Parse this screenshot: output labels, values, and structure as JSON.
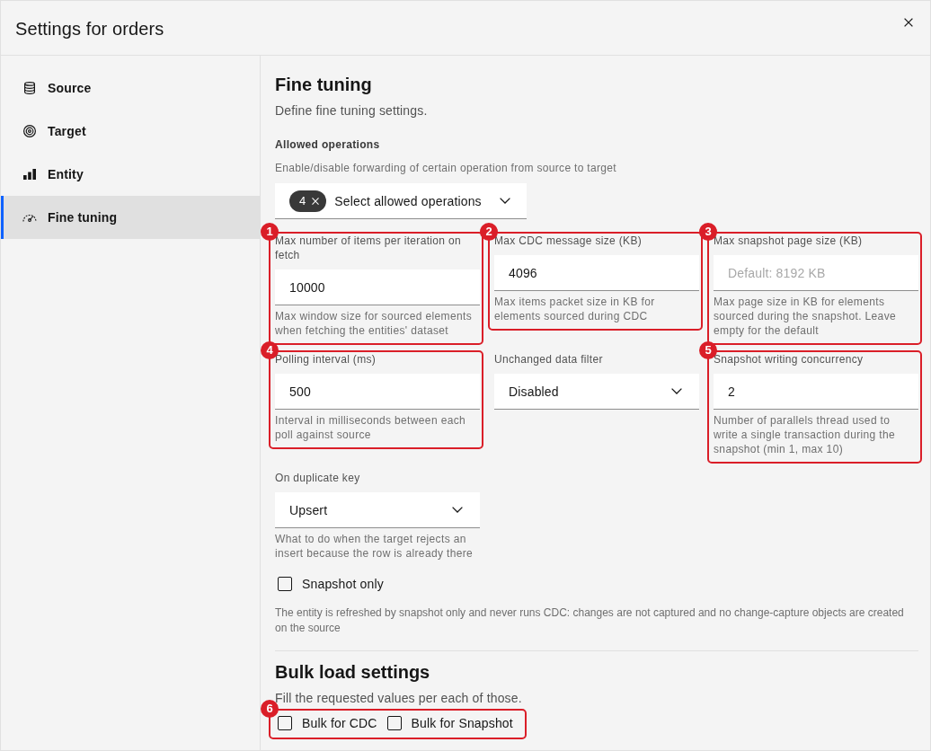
{
  "window": {
    "title": "Settings for orders"
  },
  "sidebar": {
    "items": [
      {
        "kind": "source",
        "label": "Source",
        "selected": false
      },
      {
        "kind": "target",
        "label": "Target",
        "selected": false
      },
      {
        "kind": "entity",
        "label": "Entity",
        "selected": false
      },
      {
        "kind": "tuning",
        "label": "Fine tuning",
        "selected": true
      }
    ]
  },
  "main": {
    "title": "Fine tuning",
    "description": "Define fine tuning settings.",
    "allowed_operations": {
      "label": "Allowed operations",
      "helper": "Enable/disable forwarding of certain operation from source to target",
      "selected_count": "4",
      "text": "Select allowed operations"
    },
    "fields": [
      {
        "kind": "input",
        "callout": "1",
        "label": "Max number of items per iteration on fetch",
        "value": "10000",
        "helper": "Max window size for sourced elements when fetching the entities' dataset"
      },
      {
        "kind": "input",
        "callout": "2",
        "label": "Max CDC message size (KB)",
        "value": "4096",
        "helper": "Max items packet size in KB for elements sourced during CDC"
      },
      {
        "kind": "input",
        "callout": "3",
        "label": "Max snapshot page size (KB)",
        "placeholder": "Default: 8192 KB",
        "helper": "Max page size in KB for elements sourced during the snapshot. Leave empty for the default"
      },
      {
        "kind": "input",
        "callout": "4",
        "label": "Polling interval (ms)",
        "value": "500",
        "helper": "Interval in milliseconds between each poll against source"
      },
      {
        "kind": "select",
        "label": "Unchanged data filter",
        "value": "Disabled"
      },
      {
        "kind": "input",
        "callout": "5",
        "label": "Snapshot writing concurrency",
        "value": "2",
        "helper": "Number of parallels thread used to write a single transaction during the snapshot (min 1, max 10)"
      },
      {
        "kind": "select",
        "label": "On duplicate key",
        "value": "Upsert",
        "helper": "What to do when the target rejects an insert because the row is already there"
      }
    ],
    "snapshot_only": {
      "label": "Snapshot only",
      "checked": false,
      "helper": "The entity is refreshed by snapshot only and never runs CDC: changes are not captured and no change-capture objects are created on the source"
    },
    "bulk_load": {
      "title": "Bulk load settings",
      "description": "Fill the requested values per each of those.",
      "callout": "6",
      "options": [
        {
          "label": "Bulk for CDC",
          "checked": false
        },
        {
          "label": "Bulk for Snapshot",
          "checked": false
        }
      ]
    }
  }
}
